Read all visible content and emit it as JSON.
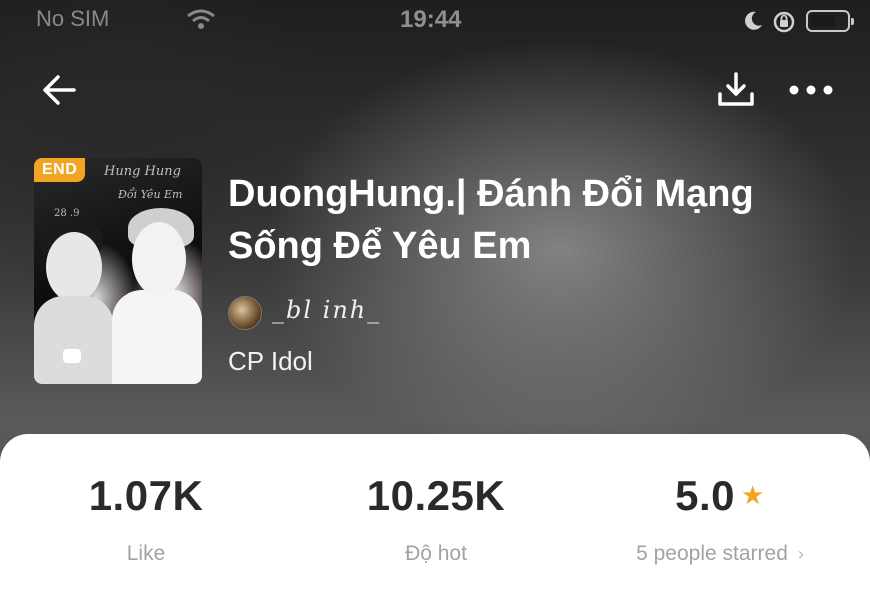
{
  "status_bar": {
    "carrier": "No SIM",
    "time": "19:44"
  },
  "book": {
    "badge": "END",
    "title": "DuongHung.| Đánh Đổi Mạng Sống Để Yêu Em",
    "author": "_bl inh_",
    "category": "CP Idol",
    "cover_text": {
      "script_top": "Hung Hung",
      "script_bottom": "Đổi Yêu Em",
      "date": "28 .9"
    }
  },
  "stats": [
    {
      "value": "1.07K",
      "label": "Like"
    },
    {
      "value": "10.25K",
      "label": "Độ hot"
    },
    {
      "value": "5.0",
      "label": "5 people starred"
    }
  ],
  "icons": {
    "back": "arrow-left-icon",
    "download": "download-icon",
    "more": "more-dots-icon",
    "star": "star-icon",
    "chevron": "chevron-right-icon"
  },
  "colors": {
    "accent": "#f2a523",
    "stat_value": "#2a2a2a",
    "stat_label": "#a3a3a3"
  }
}
